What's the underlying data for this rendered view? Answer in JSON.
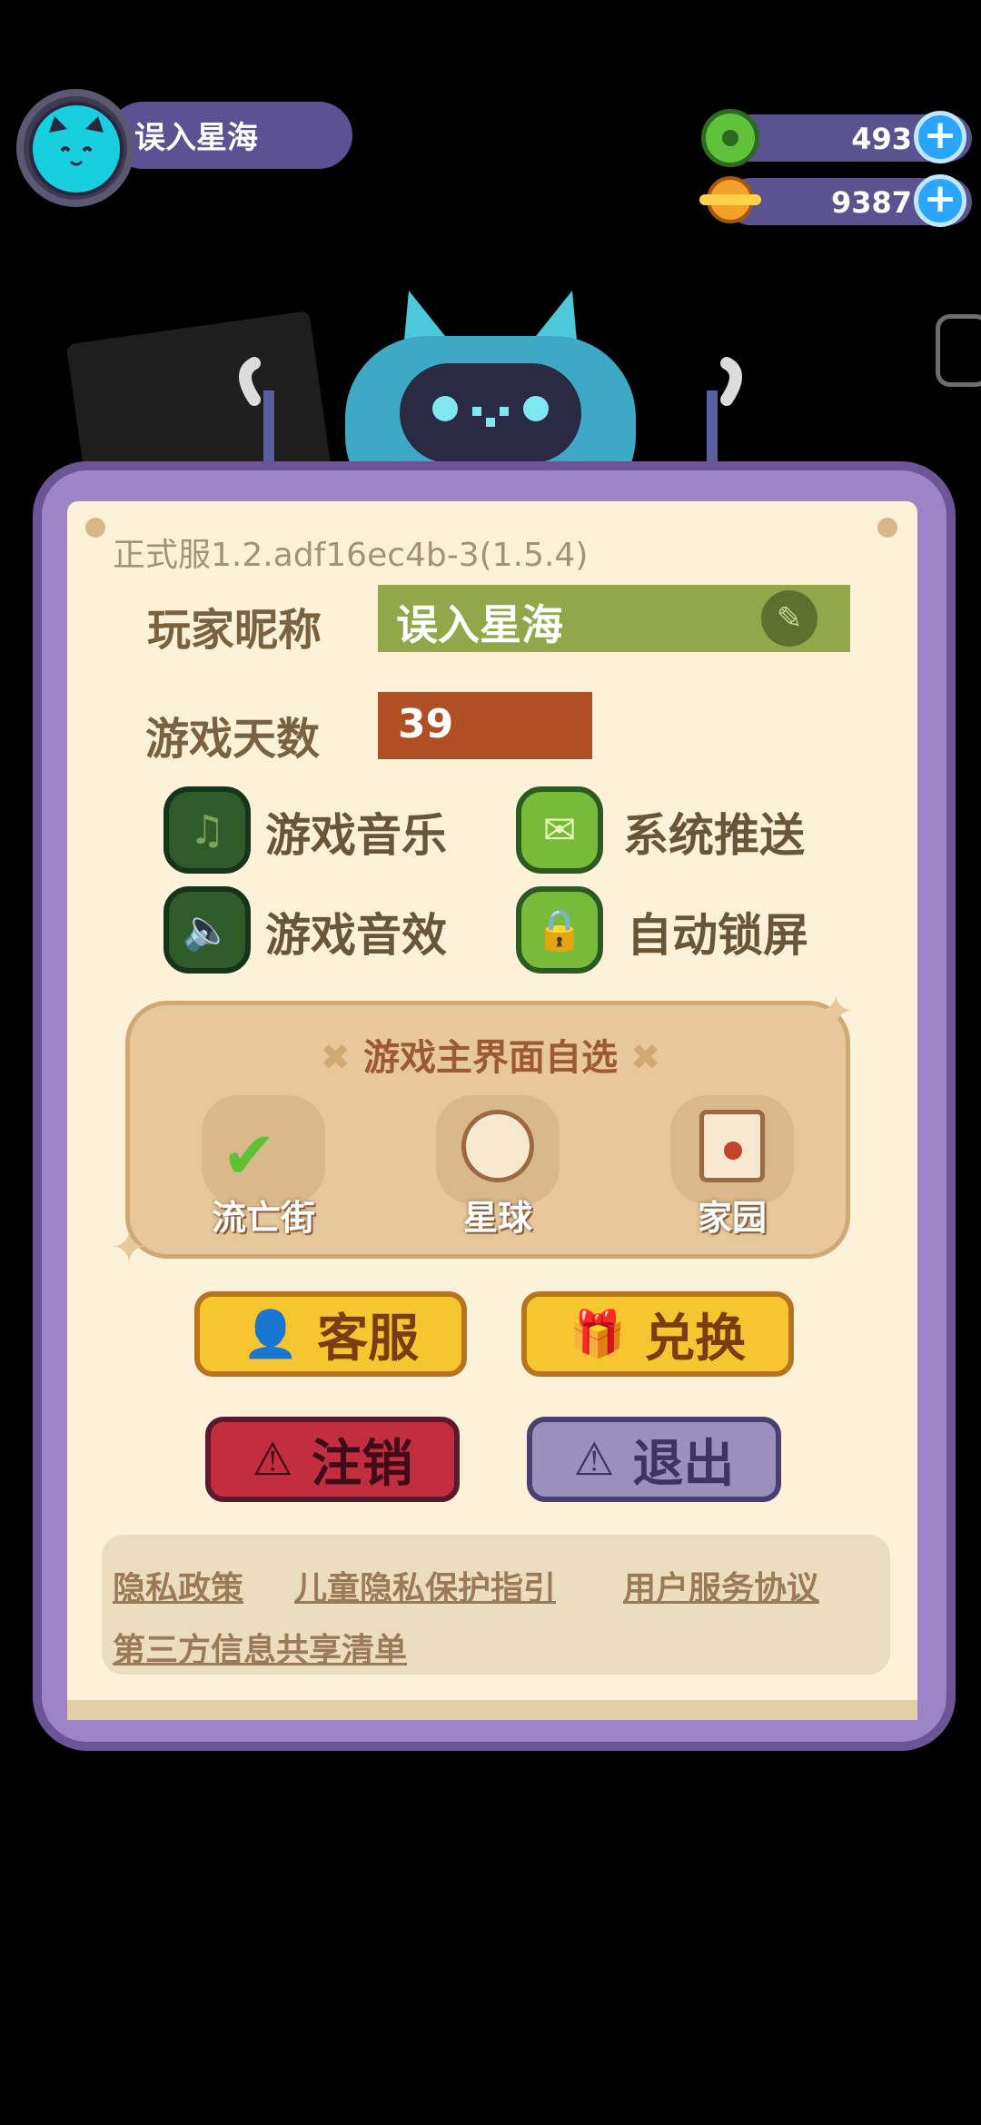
{
  "user": {
    "name": "误入星海"
  },
  "currency": {
    "green_amount": "493",
    "coin_amount": "9387"
  },
  "settings": {
    "version": "正式服1.2.adf16ec4b-3(1.5.4)",
    "nickname_label": "玩家昵称",
    "nickname_value": "误入星海",
    "days_label": "游戏天数",
    "days_value": "39",
    "toggles": [
      {
        "label": "游戏音乐",
        "icon": "music-note-icon",
        "on": false
      },
      {
        "label": "系统推送",
        "icon": "envelope-icon",
        "on": true
      },
      {
        "label": "游戏音效",
        "icon": "speaker-icon",
        "on": false
      },
      {
        "label": "自动锁屏",
        "icon": "lock-icon",
        "on": true
      }
    ]
  },
  "theme": {
    "title": "游戏主界面自选",
    "options": [
      {
        "label": "流亡街",
        "selected": true
      },
      {
        "label": "星球",
        "selected": false
      },
      {
        "label": "家园",
        "selected": false
      }
    ]
  },
  "buttons": {
    "service": "客服",
    "redeem": "兑换",
    "logout": "注销",
    "exit": "退出"
  },
  "links": {
    "privacy": "隐私政策",
    "child_privacy": "儿童隐私保护指引",
    "terms": "用户服务协议",
    "third_party": "第三方信息共享清单"
  },
  "colors": {
    "panel": "#9d84c7",
    "paper": "#fdf2d9",
    "accent_green": "#92a64a",
    "accent_orange": "#b04f23"
  }
}
